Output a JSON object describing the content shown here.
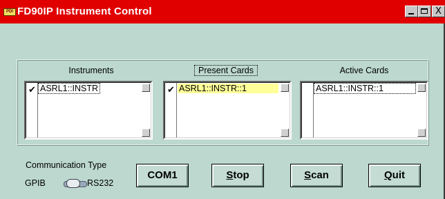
{
  "window": {
    "title": "FD90IP Instrument Control",
    "app_icon_text": "PDI"
  },
  "titlebar_buttons": {
    "minimize": "_",
    "maximize": "□",
    "close": "X"
  },
  "instruments": {
    "label": "Instruments",
    "items": [
      {
        "text": "ASRL1::INSTR",
        "checked": true,
        "check": "✔"
      }
    ]
  },
  "present_cards": {
    "label": "Present Cards",
    "items": [
      {
        "text": "ASRL1::INSTR::1",
        "checked": true,
        "check": "✔"
      }
    ]
  },
  "active_cards": {
    "label": "Active Cards",
    "items": [
      {
        "text": "ASRL1::INSTR::1",
        "checked": false
      }
    ]
  },
  "communication": {
    "label": "Communication Type",
    "left_option": "GPIB",
    "right_option": "RS232",
    "selected": "RS232"
  },
  "buttons": {
    "com": "COM1",
    "stop": {
      "accel": "S",
      "rest": "top"
    },
    "scan": {
      "accel": "S",
      "rest": "can"
    },
    "quit": {
      "accel": "Q",
      "rest": "uit"
    }
  },
  "colors": {
    "titlebar": "#e00000",
    "window_bg": "#bcd8cf",
    "selection_highlight": "#ffff99"
  }
}
